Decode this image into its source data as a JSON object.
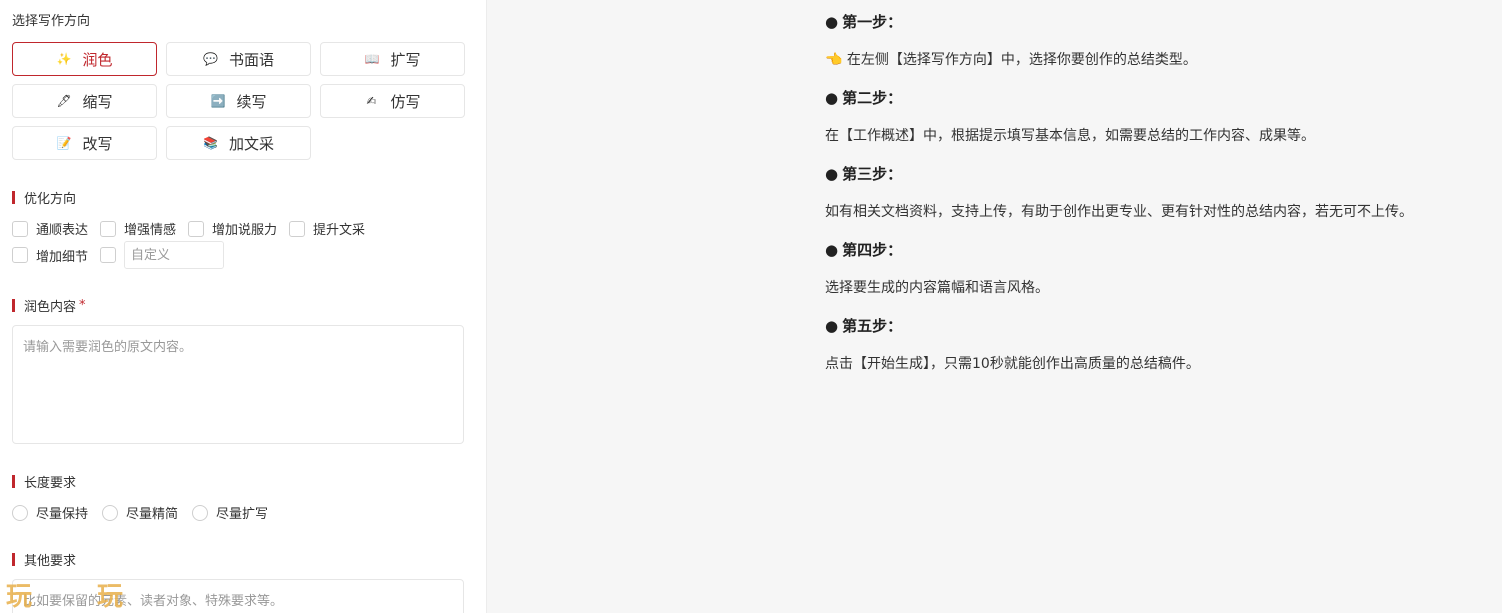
{
  "left": {
    "direction_title": "选择写作方向",
    "modes": [
      {
        "icon": "✨",
        "icon_name": "sparkles-icon",
        "label": "润色",
        "active": true
      },
      {
        "icon": "💬",
        "icon_name": "speech-bubble-icon",
        "label": "书面语",
        "active": false
      },
      {
        "icon": "📖",
        "icon_name": "book-icon",
        "label": "扩写",
        "active": false
      },
      {
        "icon": "🖋",
        "icon_name": "pen-icon",
        "label": "缩写",
        "active": false
      },
      {
        "icon": "➡️",
        "icon_name": "arrow-right-icon",
        "label": "续写",
        "active": false
      },
      {
        "icon": "✍",
        "icon_name": "writing-hand-icon",
        "label": "仿写",
        "active": false
      },
      {
        "icon": "📝",
        "icon_name": "memo-icon",
        "label": "改写",
        "active": false
      },
      {
        "icon": "📚",
        "icon_name": "books-icon",
        "label": "加文采",
        "active": false
      }
    ],
    "optimize": {
      "title": "优化方向",
      "options": [
        "通顺表达",
        "增强情感",
        "增加说服力",
        "提升文采",
        "增加细节"
      ],
      "custom_placeholder": "自定义"
    },
    "content": {
      "title": "润色内容",
      "required_mark": "*",
      "placeholder": "请输入需要润色的原文内容。"
    },
    "length": {
      "title": "长度要求",
      "options": [
        "尽量保持",
        "尽量精简",
        "尽量扩写"
      ]
    },
    "other": {
      "title": "其他要求",
      "placeholder": "比如要保留的元素、读者对象、特殊要求等。"
    },
    "watermark": "玩 玩"
  },
  "guide": {
    "bullet": "●",
    "steps": [
      {
        "title": "第一步：",
        "desc": "👈 在左侧【选择写作方向】中，选择你要创作的总结类型。"
      },
      {
        "title": "第二步：",
        "desc": "在【工作概述】中，根据提示填写基本信息，如需要总结的工作内容、成果等。"
      },
      {
        "title": "第三步：",
        "desc": "如有相关文档资料，支持上传，有助于创作出更专业、更有针对性的总结内容，若无可不上传。"
      },
      {
        "title": "第四步：",
        "desc": "选择要生成的内容篇幅和语言风格。"
      },
      {
        "title": "第五步：",
        "desc": "点击【开始生成】，只需10秒就能创作出高质量的总结稿件。"
      }
    ]
  },
  "colors": {
    "accent": "#c0272d",
    "panel_bg": "#ffffff",
    "page_bg": "#f6f6f6"
  }
}
